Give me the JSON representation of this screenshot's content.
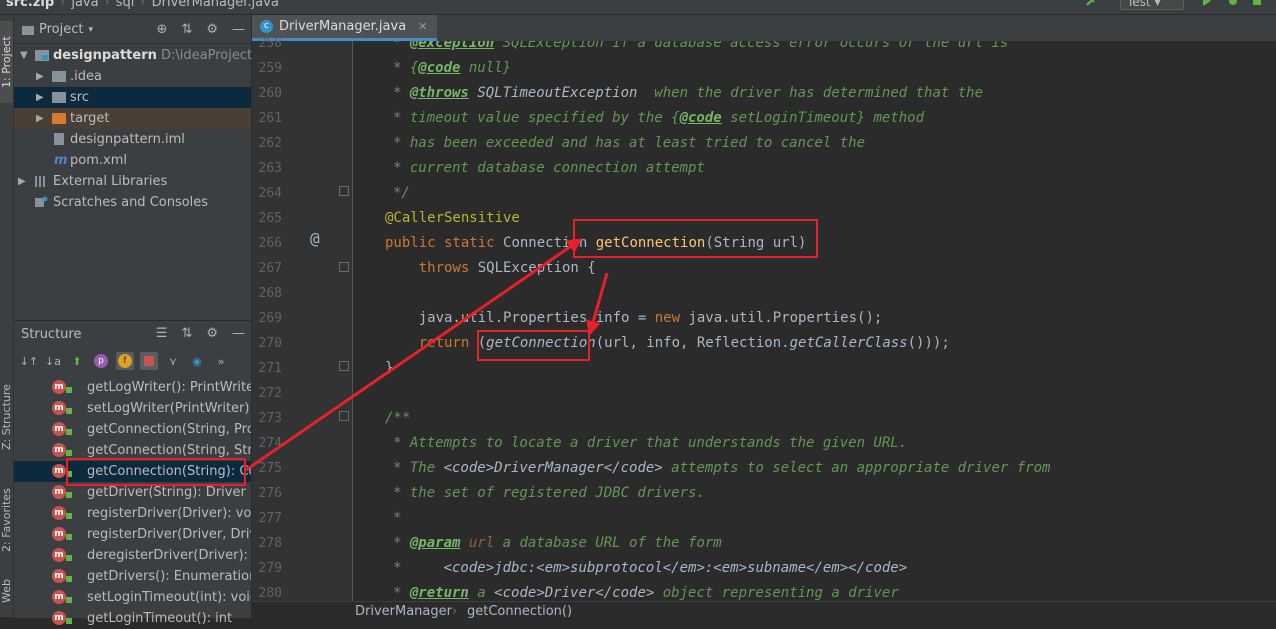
{
  "navbar": {
    "crumbs": [
      "src.zip",
      "java",
      "sql",
      "DriverManager.java"
    ],
    "run_config": "Test"
  },
  "left_strip": {
    "project_tab": "1: Project",
    "structure_tab": "Z: Structure",
    "favorites_tab": "2: Favorites",
    "web_tab": "Web"
  },
  "project": {
    "title": "Project",
    "tree": [
      {
        "label": "designpattern",
        "path": "D:\\ideaProjects\\de"
      },
      {
        "label": ".idea"
      },
      {
        "label": "src"
      },
      {
        "label": "target"
      },
      {
        "label": "designpattern.iml"
      },
      {
        "label": "pom.xml"
      },
      {
        "label": "External Libraries"
      },
      {
        "label": "Scratches and Consoles"
      }
    ]
  },
  "structure": {
    "title": "Structure",
    "items": [
      "getLogWriter(): PrintWriter",
      "setLogWriter(PrintWriter): void",
      "getConnection(String, Prope",
      "getConnection(String, String",
      "getConnection(String): Conn",
      "getDriver(String): Driver",
      "registerDriver(Driver): void",
      "registerDriver(Driver, DriverA",
      "deregisterDriver(Driver): voic",
      "getDrivers(): Enumeration<D",
      "setLoginTimeout(int): void",
      "getLoginTimeout(): int"
    ]
  },
  "editor": {
    "tab_label": "DriverManager.java",
    "line_numbers": [
      "258",
      "259",
      "260",
      "261",
      "262",
      "263",
      "264",
      "265",
      "266",
      "267",
      "268",
      "269",
      "270",
      "271",
      "272",
      "273",
      "274",
      "275",
      "276",
      "277",
      "278",
      "279",
      "280"
    ],
    "lines": {
      "l258a": "* ",
      "l258b": "@exception",
      "l258c": " SQLException if a database access error occurs or the url is",
      "l259a": "* {",
      "l259b": "@code",
      "l259c": " null}",
      "l260a": "* ",
      "l260b": "@throws",
      "l260c": " SQLTimeoutException",
      "l260d": "  when the driver has determined that the",
      "l261a": "* timeout value specified by the {",
      "l261b": "@code",
      "l261c": " setLoginTimeout} method",
      "l262": "* has been exceeded and has at least tried to cancel the",
      "l263": "* current database connection attempt",
      "l264": "*/",
      "l265": "@CallerSensitive",
      "l266a": "public static ",
      "l266b": "Connection ",
      "l266c": "getConnection",
      "l266d": "(String url)",
      "l267a": "    throws ",
      "l267b": "SQLException {",
      "l269a": "    java.util.Properties info = ",
      "l269b": "new ",
      "l269c": "java.util.Properties();",
      "l270a": "    return ",
      "l270b": "(",
      "l270c": "getConnection",
      "l270d": "(url, info, Reflection.",
      "l270e": "getCallerClass",
      "l270f": "()));",
      "l271": "}",
      "l273": "/**",
      "l274": "* Attempts to locate a driver that understands the given URL.",
      "l275a": "* The ",
      "l275b": "<code>DriverManager</code>",
      "l275c": " attempts to select an appropriate driver from",
      "l276": "* the set of registered JDBC drivers.",
      "l277": "*",
      "l278a": "* ",
      "l278b": "@param",
      "l278c": " url",
      "l278d": " a database URL of the form",
      "l279a": "*     ",
      "l279b": "<code>jdbc:<em>subprotocol</em>:<em>subname</em></code>",
      "l280a": "* ",
      "l280b": "@return",
      "l280c": " a ",
      "l280d": "<code>Driver</code>",
      "l280e": " object representing a driver"
    },
    "gutter_at": "@"
  },
  "breadcrumb": [
    "DriverManager",
    "getConnection()"
  ],
  "colors": {
    "accent_blue": "#4a88c7",
    "annotation_red": "#e8202a"
  }
}
